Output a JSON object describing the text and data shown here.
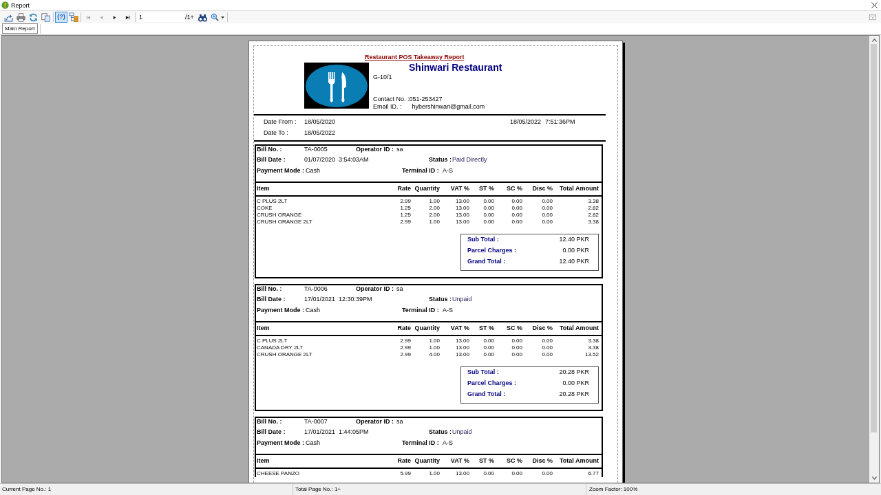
{
  "window": {
    "title": "Report"
  },
  "toolbar": {
    "toggles": [
      {
        "kind": "help",
        "label": "(?)",
        "selected": true
      },
      {
        "kind": "group_tree",
        "selected": false
      }
    ],
    "navigation": [
      {
        "kind": "first",
        "disabled": true
      },
      {
        "kind": "previous",
        "disabled": true
      },
      {
        "kind": "next",
        "disabled": false
      },
      {
        "kind": "last",
        "disabled": false
      }
    ],
    "page_field": {
      "value": "1"
    },
    "page_count": "/1+"
  },
  "tabs": [
    {
      "label": "Main Report",
      "selected": true
    }
  ],
  "report": {
    "title": "Restaurant POS Takeaway Report",
    "restaurant_name": "Shinwari Restaurant",
    "address": "G-10/1",
    "contact": "Contact No. :051-253427",
    "email": {
      "label": "Email ID. :",
      "value": "hybershinwari@gmail.com"
    },
    "date_range": [
      {
        "label": "Date From :",
        "value": "18/05/2020"
      },
      {
        "label": "Date To :",
        "value": "18/05/2022"
      }
    ],
    "printed_at": {
      "date": "18/05/2022",
      "time": "7:51:36PM"
    },
    "bills": [
      {
        "bill_no": {
          "label": "Bill No. :",
          "value": "TA-0005"
        },
        "operator_id": {
          "label": "Operator ID :",
          "value": "sa"
        },
        "bill_date": {
          "label": "Bill Date :",
          "date": "01/07/2020",
          "time": "3:54:03AM"
        },
        "status": {
          "label": "Status :",
          "value": "Paid Directly"
        },
        "payment_mode": {
          "label": "Payment Mode :",
          "value": "Cash"
        },
        "terminal_id": {
          "label": "Terminal ID :",
          "value": "A-S"
        },
        "columns": [
          "Item",
          "Rate",
          "Quantity",
          "VAT %",
          "ST %",
          "SC %",
          "Disc %",
          "Total Amount"
        ],
        "items": [
          {
            "cells": [
              "C PLUS 2LT",
              "2.99",
              "1.00",
              "13.00",
              "0.00",
              "0.00",
              "0.00",
              "3.38"
            ]
          },
          {
            "cells": [
              "COKE",
              "1.25",
              "2.00",
              "13.00",
              "0.00",
              "0.00",
              "0.00",
              "2.82"
            ]
          },
          {
            "cells": [
              "CRUSH ORANGE",
              "1.25",
              "2.00",
              "13.00",
              "0.00",
              "0.00",
              "0.00",
              "2.82"
            ]
          },
          {
            "cells": [
              "CRUSH ORANGE 2LT",
              "2.99",
              "1.00",
              "13.00",
              "0.00",
              "0.00",
              "0.00",
              "3.38"
            ]
          }
        ],
        "totals": [
          {
            "label": "Sub Total :",
            "value": "12.40 PKR"
          },
          {
            "label": "Parcel Charges :",
            "value": "0.00 PKR"
          },
          {
            "label": "Grand Total :",
            "value": "12.40 PKR"
          }
        ]
      },
      {
        "bill_no": {
          "label": "Bill No. :",
          "value": "TA-0006"
        },
        "operator_id": {
          "label": "Operator ID :",
          "value": "sa"
        },
        "bill_date": {
          "label": "Bill Date :",
          "date": "17/01/2021",
          "time": "12:30:39PM"
        },
        "status": {
          "label": "Status :",
          "value": "Unpaid"
        },
        "payment_mode": {
          "label": "Payment Mode :",
          "value": "Cash"
        },
        "terminal_id": {
          "label": "Terminal ID :",
          "value": "A-S"
        },
        "columns": [
          "Item",
          "Rate",
          "Quantity",
          "VAT %",
          "ST %",
          "SC %",
          "Disc %",
          "Total Amount"
        ],
        "items": [
          {
            "cells": [
              "C PLUS 2LT",
              "2.99",
              "1.00",
              "13.00",
              "0.00",
              "0.00",
              "0.00",
              "3.38"
            ]
          },
          {
            "cells": [
              "CANADA DRY 2LT",
              "2.99",
              "1.00",
              "13.00",
              "0.00",
              "0.00",
              "0.00",
              "3.38"
            ]
          },
          {
            "cells": [
              "CRUSH ORANGE 2LT",
              "2.99",
              "4.00",
              "13.00",
              "0.00",
              "0.00",
              "0.00",
              "13.52"
            ]
          }
        ],
        "totals": [
          {
            "label": "Sub Total :",
            "value": "20.28 PKR"
          },
          {
            "label": "Parcel Charges :",
            "value": "0.00 PKR"
          },
          {
            "label": "Grand Total :",
            "value": "20.28 PKR"
          }
        ]
      },
      {
        "bill_no": {
          "label": "Bill No. :",
          "value": "TA-0007"
        },
        "operator_id": {
          "label": "Operator ID :",
          "value": "sa"
        },
        "bill_date": {
          "label": "Bill Date :",
          "date": "17/01/2021",
          "time": "1:44:05PM"
        },
        "status": {
          "label": "Status :",
          "value": "Unpaid"
        },
        "payment_mode": {
          "label": "Payment Mode :",
          "value": "Cash"
        },
        "terminal_id": {
          "label": "Terminal ID :",
          "value": "A-S"
        },
        "columns": [
          "Item",
          "Rate",
          "Quantity",
          "VAT %",
          "ST %",
          "SC %",
          "Disc %",
          "Total Amount"
        ],
        "items": [
          {
            "cells": [
              "CHEESE PANZO",
              "5.99",
              "1.00",
              "13.00",
              "0.00",
              "0.00",
              "0.00",
              "6.77"
            ]
          }
        ]
      }
    ]
  },
  "status_bar": [
    "Current Page No.: 1",
    "Total Page No.: 1+",
    "Zoom Factor: 100%"
  ]
}
